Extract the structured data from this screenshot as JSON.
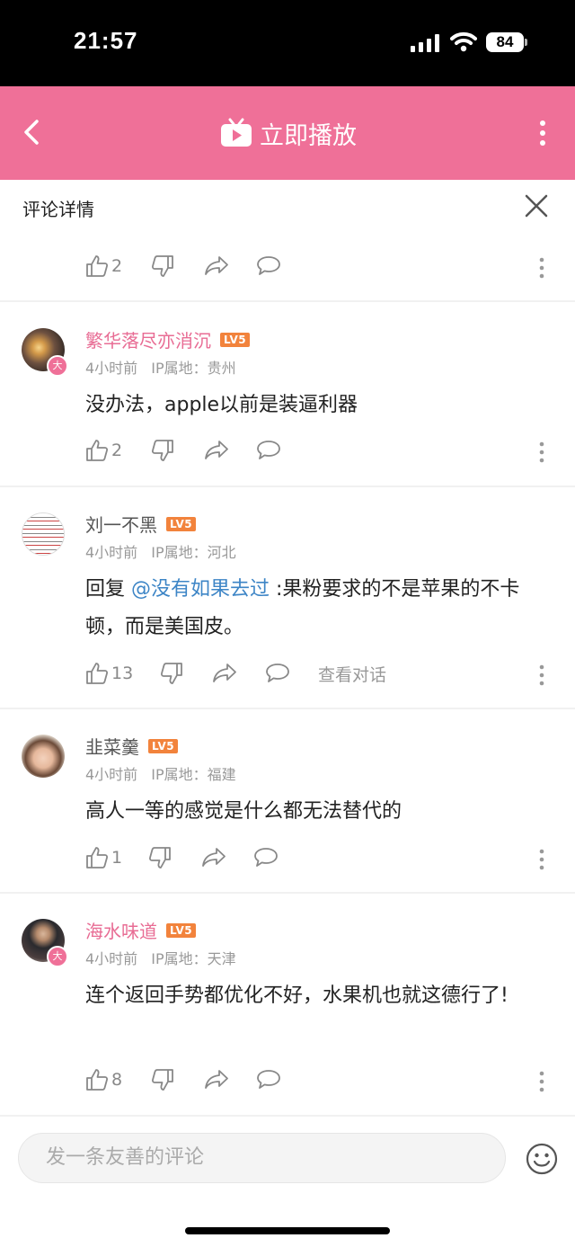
{
  "status_bar": {
    "time": "21:57",
    "battery": "84"
  },
  "nav": {
    "title": "立即播放"
  },
  "sheet": {
    "title": "评论详情"
  },
  "top_actions": {
    "likes": "2"
  },
  "comments": [
    {
      "user": "繁华落尽亦消沉",
      "level": "LV5",
      "time": "4小时前",
      "ip": "IP属地：贵州",
      "text": "没办法，apple以前是装逼利器",
      "likes": "2",
      "badge": "大"
    },
    {
      "user": "刘一不黑",
      "level": "LV5",
      "time": "4小时前",
      "ip": "IP属地：河北",
      "reply_prefix": "回复 ",
      "mention": "@没有如果去过",
      "text_rest": " :果粉要求的不是苹果的不卡顿，而是美国皮。",
      "likes": "13",
      "view_conversation": "查看对话"
    },
    {
      "user": "韭菜羹",
      "level": "LV5",
      "time": "4小时前",
      "ip": "IP属地：福建",
      "text": "高人一等的感觉是什么都无法替代的",
      "likes": "1"
    },
    {
      "user": "海水味道",
      "level": "LV5",
      "time": "4小时前",
      "ip": "IP属地：天津",
      "text": "连个返回手势都优化不好，水果机也就这德行了!",
      "likes": "8",
      "badge": "大"
    }
  ],
  "input": {
    "placeholder": "发一条友善的评论"
  },
  "colors": {
    "brand_pink": "#ef7098",
    "level_orange": "#f2833c",
    "mention_blue": "#3d85c6"
  }
}
